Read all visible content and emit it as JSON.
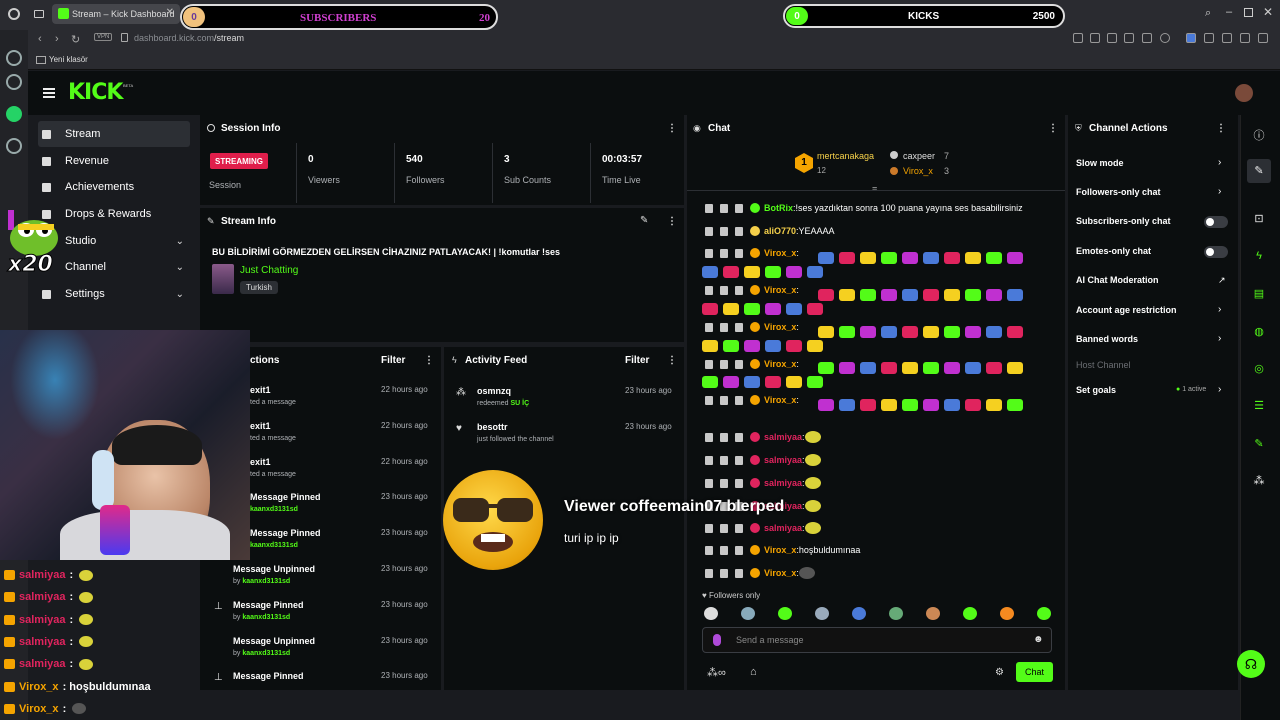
{
  "browser": {
    "tab_title": "Stream – Kick Dashboard",
    "url_domain": "dashboard.kick.com",
    "url_path": "/stream",
    "vpn_label": "VPN",
    "bookmark_folder": "Yeni klasör"
  },
  "goals": {
    "subscribers": {
      "label": "SUBSCRIBERS",
      "current": "0",
      "target": "20"
    },
    "kicks": {
      "label": "KICKS",
      "current": "0",
      "target": "2500"
    }
  },
  "sidebar": {
    "items": [
      {
        "label": "Stream"
      },
      {
        "label": "Revenue"
      },
      {
        "label": "Achievements"
      },
      {
        "label": "Drops & Rewards"
      },
      {
        "label": "Studio"
      },
      {
        "label": "Channel"
      },
      {
        "label": "Settings"
      }
    ]
  },
  "session": {
    "title": "Session Info",
    "status": "STREAMING",
    "status_label": "Session",
    "stats": [
      {
        "value": "0",
        "label": "Viewers"
      },
      {
        "value": "540",
        "label": "Followers"
      },
      {
        "value": "3",
        "label": "Sub Counts"
      },
      {
        "value": "00:03:57",
        "label": "Time Live"
      }
    ]
  },
  "stream_info": {
    "title": "Stream Info",
    "stream_title": "BU BİLDİRİMİ GÖRMEZDEN GELİRSEN CİHAZINIZ PATLAYACAK! | !komutlar !ses",
    "category": "Just Chatting",
    "tag": "Turkish"
  },
  "mod_actions": {
    "title": "ctions",
    "filter": "Filter",
    "items": [
      {
        "title": "exit1",
        "sub": "ted a message",
        "by": "",
        "time": "22 hours ago"
      },
      {
        "title": "exit1",
        "sub": "ted a message",
        "by": "",
        "time": "22 hours ago"
      },
      {
        "title": "exit1",
        "sub": "ted a message",
        "by": "",
        "time": "22 hours ago"
      },
      {
        "title": "Message Pinned",
        "sub": "",
        "by": "kaanxd3131sd",
        "time": "23 hours ago"
      },
      {
        "title": "Message Pinned",
        "sub": "",
        "by": "kaanxd3131sd",
        "time": "23 hours ago"
      },
      {
        "title": "Message Unpinned",
        "sub": "by ",
        "by": "kaanxd3131sd",
        "time": "23 hours ago"
      },
      {
        "title": "Message Pinned",
        "sub": "by ",
        "by": "kaanxd3131sd",
        "time": "23 hours ago"
      },
      {
        "title": "Message Unpinned",
        "sub": "by ",
        "by": "kaanxd3131sd",
        "time": "23 hours ago"
      },
      {
        "title": "Message Pinned",
        "sub": "",
        "by": "",
        "time": "23 hours ago"
      }
    ]
  },
  "activity": {
    "title": "Activity Feed",
    "filter": "Filter",
    "items": [
      {
        "user": "osmnzq",
        "action": "redeemed ",
        "extra": "SU İÇ",
        "time": "23 hours ago"
      },
      {
        "user": "besottr",
        "action": "just followed the channel",
        "extra": "",
        "time": "23 hours ago"
      }
    ]
  },
  "alert": {
    "title": "Viewer coffeemain07 blerped",
    "message": "turi ip ip ip"
  },
  "chat": {
    "title": "Chat",
    "top_gifters": [
      {
        "name": "mertcanakaga",
        "count": "12"
      },
      {
        "name": "caxpeer",
        "count": "7"
      },
      {
        "name": "Virox_x",
        "count": "3"
      }
    ],
    "messages": [
      {
        "user": "BotRix",
        "color": "#53fc18",
        "text": "!ses yazdıktan sonra 100 puana yayına ses basabilirsiniz"
      },
      {
        "user": "aliO770",
        "color": "#f5d04a",
        "text": "YEAAAA"
      },
      {
        "user": "Virox_x",
        "color": "#f5a400",
        "text": ""
      },
      {
        "user": "Virox_x",
        "color": "#f5a400",
        "text": ""
      },
      {
        "user": "Virox_x",
        "color": "#f5a400",
        "text": ""
      },
      {
        "user": "Virox_x",
        "color": "#f5a400",
        "text": ""
      },
      {
        "user": "Virox_x",
        "color": "#f5a400",
        "text": ""
      },
      {
        "user": "salmiyaa",
        "color": "#e0245e",
        "text": ""
      },
      {
        "user": "salmiyaa",
        "color": "#e0245e",
        "text": ""
      },
      {
        "user": "salmiyaa",
        "color": "#e0245e",
        "text": ""
      },
      {
        "user": "salmiyaa",
        "color": "#e0245e",
        "text": ""
      },
      {
        "user": "salmiyaa",
        "color": "#e0245e",
        "text": ""
      },
      {
        "user": "Virox_x",
        "color": "#f5a400",
        "text": "hoşbuldumınaa"
      },
      {
        "user": "Virox_x",
        "color": "#f5a400",
        "text": ""
      }
    ],
    "followers_only": "Followers only",
    "input_placeholder": "Send a message",
    "send_label": "Chat"
  },
  "channel_actions": {
    "title": "Channel Actions",
    "items": [
      {
        "label": "Slow mode",
        "control": "chevron"
      },
      {
        "label": "Followers-only chat",
        "control": "chevron"
      },
      {
        "label": "Subscribers-only chat",
        "control": "toggle"
      },
      {
        "label": "Emotes-only chat",
        "control": "toggle"
      },
      {
        "label": "AI Chat Moderation",
        "control": "link"
      },
      {
        "label": "Account age restriction",
        "control": "chevron"
      },
      {
        "label": "Banned words",
        "control": "chevron"
      },
      {
        "label": "Host Channel",
        "control": "none"
      },
      {
        "label": "Set goals",
        "control": "chevron",
        "badge": "1 active"
      }
    ]
  },
  "overlay_chat": [
    {
      "user": "salmiyaa",
      "text": ":"
    },
    {
      "user": "salmiyaa",
      "text": ":"
    },
    {
      "user": "salmiyaa",
      "text": ":"
    },
    {
      "user": "salmiyaa",
      "text": ":"
    },
    {
      "user": "salmiyaa",
      "text": ":"
    },
    {
      "user": "Virox_x",
      "text": ": hoşbuldumınaa"
    },
    {
      "user": "Virox_x",
      "text": ":"
    }
  ],
  "overlay_multiplier": "x20",
  "colors": {
    "accent": "#53fc18",
    "live": "#e01e4b",
    "panel": "#0b0e0f",
    "bg": "#191b1f"
  }
}
